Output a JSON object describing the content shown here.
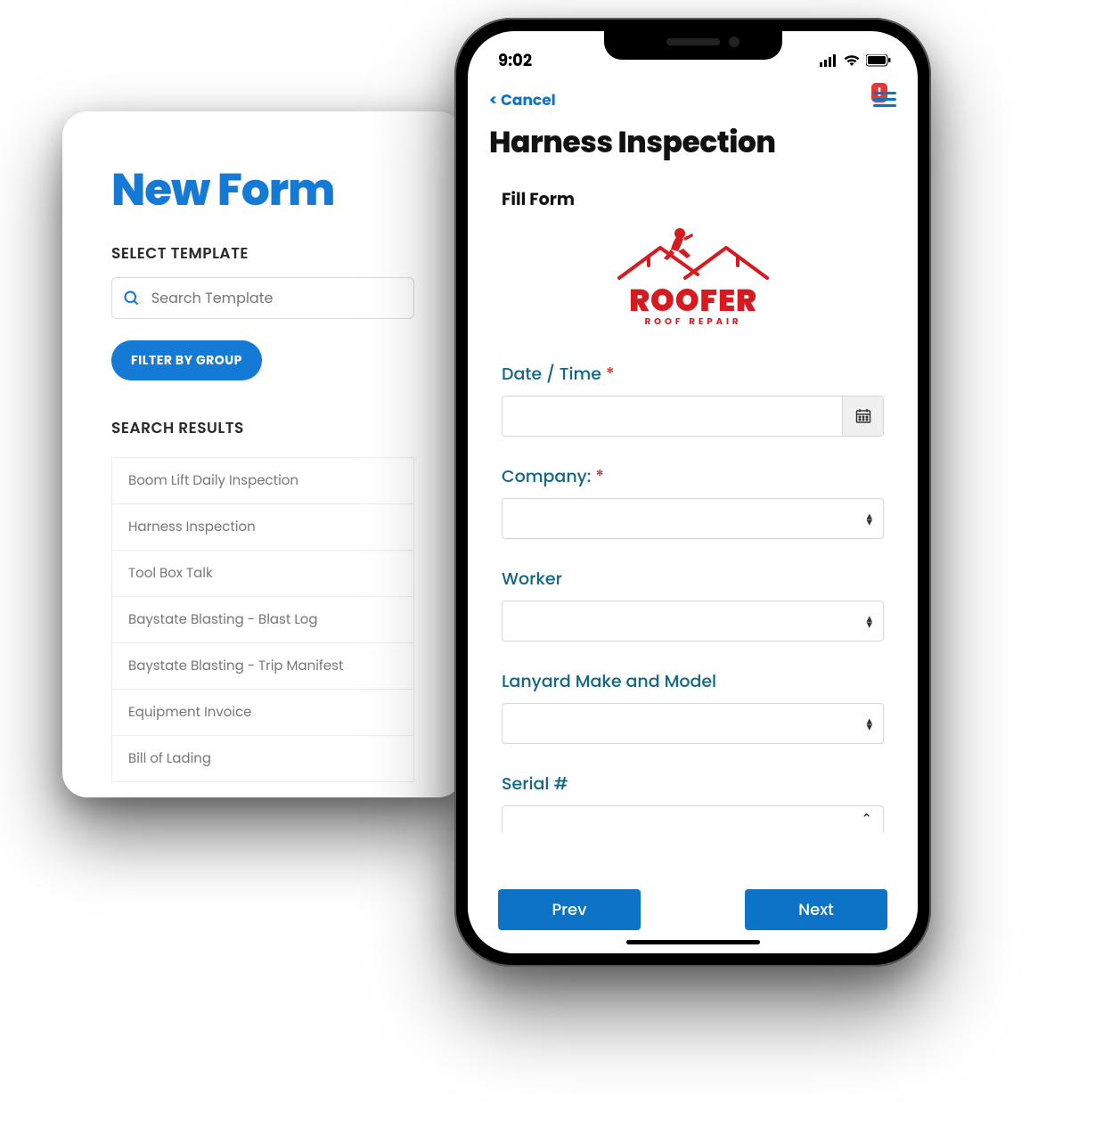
{
  "leftCard": {
    "title": "New Form",
    "subtitle": "SELECT TEMPLATE",
    "searchPlaceholder": "Search Template",
    "filterBtn": "FILTER BY GROUP",
    "resultsTitle": "SEARCH RESULTS",
    "results": [
      "Boom Lift Daily Inspection",
      "Harness Inspection",
      "Tool Box Talk",
      "Baystate Blasting - Blast Log",
      "Baystate Blasting - Trip Manifest",
      "Equipment Invoice",
      "Bill of Lading"
    ]
  },
  "phone": {
    "time": "9:02",
    "cancel": "< Cancel",
    "notifBadge": "!",
    "pageTitle": "Harness Inspection",
    "fillForm": "Fill Form",
    "logoTop": "ROOFER",
    "logoSub": "ROOF REPAIR",
    "fields": {
      "datetime": "Date / Time",
      "company": "Company:",
      "worker": "Worker",
      "lanyard": "Lanyard Make and Model",
      "serial": "Serial #"
    },
    "prev": "Prev",
    "next": "Next"
  }
}
